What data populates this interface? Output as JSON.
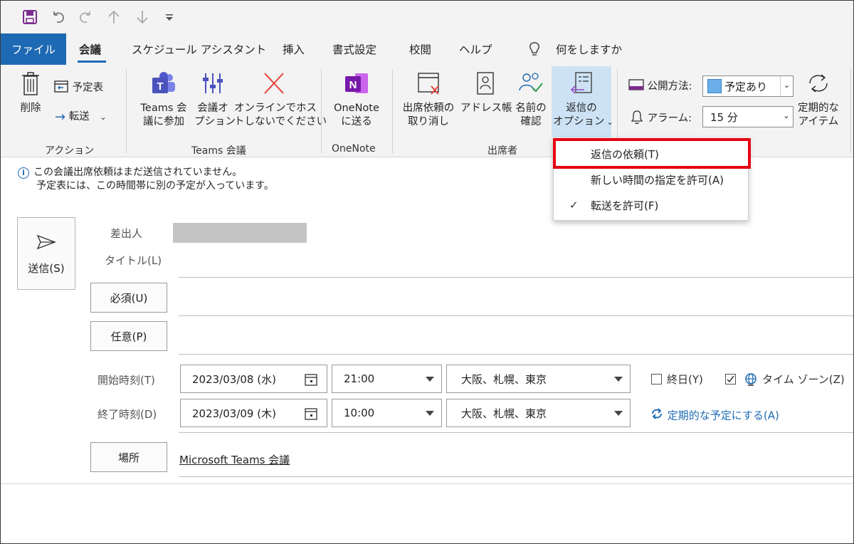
{
  "quick_access": {
    "icons": [
      "save-icon",
      "undo-icon",
      "redo-icon",
      "arrow-up-icon",
      "arrow-down-icon",
      "customize-icon"
    ]
  },
  "tabs": [
    {
      "label": "ファイル"
    },
    {
      "label": "会議"
    },
    {
      "label": "スケジュール アシスタント"
    },
    {
      "label": "挿入"
    },
    {
      "label": "書式設定"
    },
    {
      "label": "校閲"
    },
    {
      "label": "ヘルプ"
    }
  ],
  "search_label": "何をしますか",
  "ribbon": {
    "delete": "削除",
    "calendar": "予定表",
    "forward": "転送",
    "teams_join": [
      "Teams 会",
      "議に参加"
    ],
    "meeting_options": [
      "会議オ",
      "プション"
    ],
    "online_host": [
      "オンラインでホス",
      "トしないでください"
    ],
    "onenote": [
      "OneNote",
      "に送る"
    ],
    "cancel_request": [
      "出席依頼の",
      "取り消し"
    ],
    "address_book": "アドレス帳",
    "check_names": [
      "名前の",
      "確認"
    ],
    "response_options": [
      "返信の",
      "オプション"
    ],
    "show_as_label": "公開方法:",
    "show_as_value": "予定あり",
    "reminder_label": "アラーム:",
    "reminder_value": "15 分",
    "recurring": [
      "定期的な",
      "アイテム"
    ],
    "groups": {
      "actions": "アクション",
      "teams_meeting": "Teams 会議",
      "onenote": "OneNote",
      "attendees": "出席者"
    }
  },
  "info": {
    "line1": "この会議出席依頼はまだ送信されていません。",
    "line2": "予定表には、この時間帯に別の予定が入っています。"
  },
  "form": {
    "send": "送信(S)",
    "from_label": "差出人",
    "title_label": "タイトル(L)",
    "required": "必須(U)",
    "optional": "任意(P)",
    "start_label": "開始時刻(T)",
    "end_label": "終了時刻(D)",
    "start_date": "2023/03/08 (水)",
    "start_time": "21:00",
    "end_date": "2023/03/09 (木)",
    "end_time": "10:00",
    "timezone": "大阪、札幌、東京",
    "all_day": "終日(Y)",
    "time_zone_toggle": "タイム ゾーン(Z)",
    "recurrence": "定期的な予定にする(A)",
    "location_button": "場所",
    "location_value": "Microsoft Teams 会議"
  },
  "dropdown": {
    "items": [
      {
        "label": "返信の依頼(T)",
        "checked": false
      },
      {
        "label": "新しい時間の指定を許可(A)",
        "checked": false
      },
      {
        "label": "転送を許可(F)",
        "checked": true
      }
    ]
  },
  "colors": {
    "accent": "#1e69b3",
    "highlight": "#e60012"
  }
}
